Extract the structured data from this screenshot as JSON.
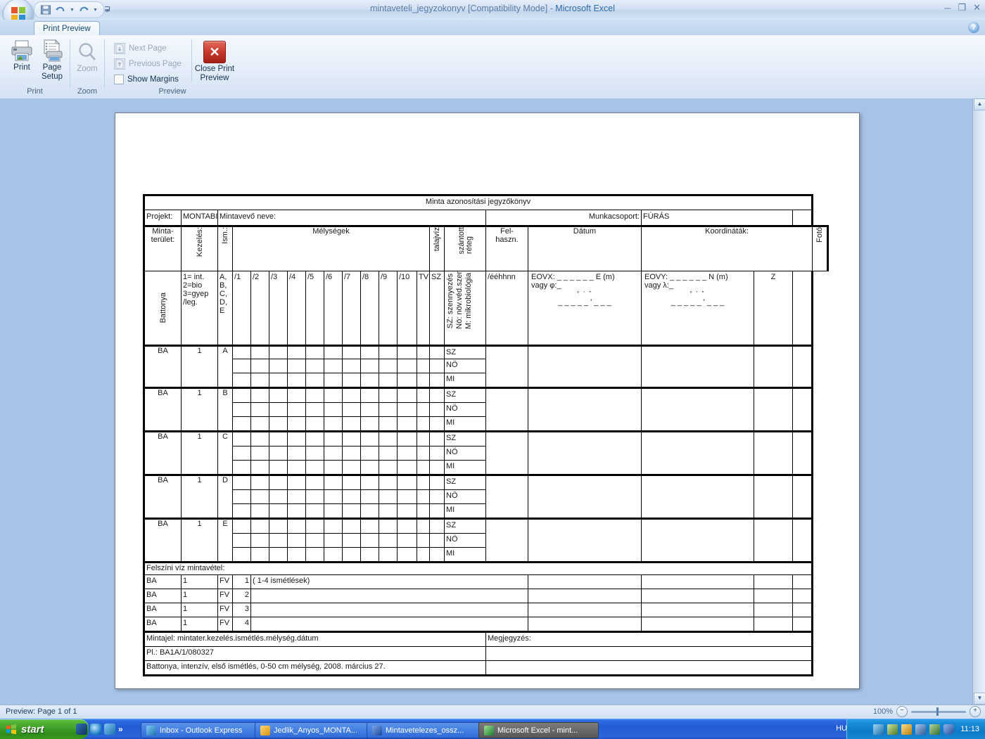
{
  "window": {
    "title_doc": "mintaveteli_jegyzokonyv",
    "title_mode": "[Compatibility Mode]",
    "title_sep": " - ",
    "title_app": "Microsoft Excel",
    "minimize": "─",
    "maximize": "❐",
    "close": "✕",
    "help": "?"
  },
  "quick_access": {
    "save": "save-icon",
    "undo": "undo-icon",
    "redo": "redo-icon",
    "customize": "customize-icon"
  },
  "ribbon": {
    "tab": "Print Preview",
    "groups": [
      {
        "label": "Print"
      },
      {
        "label": "Zoom"
      },
      {
        "label": "Preview"
      }
    ],
    "print_button": "Print",
    "page_setup_button_l1": "Page",
    "page_setup_button_l2": "Setup",
    "zoom_button": "Zoom",
    "next_page": "Next Page",
    "previous_page": "Previous Page",
    "show_margins": "Show Margins",
    "close_preview_l1": "Close Print",
    "close_preview_l2": "Preview",
    "close_glyph": "✕"
  },
  "statusbar": {
    "preview_text": "Preview: Page 1 of 1",
    "zoom_level": "100%",
    "zoom_out": "−",
    "zoom_in": "+"
  },
  "taskbar": {
    "start": "start",
    "buttons": [
      {
        "label": "Inbox - Outlook Express",
        "active": false
      },
      {
        "label": "Jedlik_Anyos_MONTA...",
        "active": false
      },
      {
        "label": "Mintavetelezes_ossz...",
        "active": false
      },
      {
        "label": "Microsoft Excel - mint...",
        "active": true
      }
    ],
    "quicklaunch_overflow": "»",
    "language": "HU",
    "clock": "11:13"
  },
  "sheet": {
    "doc_title": "Minta azonosítási jegyzőkönyv",
    "row_project": {
      "project_label": "Projekt:",
      "project_value": "MONTABIO",
      "sampler_label": "Mintavevő neve:",
      "workgroup_label": "Munkacsoport:",
      "workgroup_value": "FÚRÁS"
    },
    "headers": {
      "area_l1": "Minta-",
      "area_l2": "terület:",
      "treatment": "Kezelés:",
      "repeat": "Ism.:",
      "depths": "Mélységek",
      "groundwater": "talajvíz",
      "plowed_l1": "szántott",
      "plowed_l2": "réteg",
      "usage_l1": "Fel-",
      "usage_l2": "haszn.",
      "date": "Dátum",
      "coords": "Koordináták:",
      "photo": "Fotó"
    },
    "subheaders": {
      "area_value": "Battonya",
      "treatment_l1": "1= int.",
      "treatment_l2": "2=bio",
      "treatment_l3": "3=gyep",
      "treatment_l4": "/leg.",
      "repeat_l1": "A,",
      "repeat_l2": "B,",
      "repeat_l3": "C,",
      "repeat_l4": "D,",
      "repeat_l5": "E",
      "depth_cols": [
        "/1",
        "/2",
        "/3",
        "/4",
        "/5",
        "/6",
        "/7",
        "/8",
        "/9",
        "/10"
      ],
      "gw_code": "TV",
      "plowed_code": "SZ",
      "usage_legend_1": "SZ: szennyezés",
      "usage_legend_2": "Nö: növ.véd.szer",
      "usage_legend_3": "M: mikrobiológia",
      "date_format": "/ééhhnn",
      "eovx_line1": "EOVX: _ _ _ _ _ _ E (m)",
      "eovx_line2": "vagy                        φ:_",
      "eovx_line3": "   °        '             \"",
      "eovx_line4": "_  _ _ _ _ '  _ _ _",
      "eovy_line1": "EOVY: _ _ _ _ _ _ N (m)",
      "eovy_line2": "vagy                        λ:_",
      "eovy_line3": "   °        '             \"",
      "eovy_line4": "_  _ _ _ _ '  _ _ _",
      "z_code": "Z"
    },
    "sample_groups": [
      {
        "area": "BA",
        "treatment": "1",
        "repeat": "A",
        "usages": [
          "SZ",
          "NÖ",
          "MI"
        ]
      },
      {
        "area": "BA",
        "treatment": "1",
        "repeat": "B",
        "usages": [
          "SZ",
          "NÖ",
          "MI"
        ]
      },
      {
        "area": "BA",
        "treatment": "1",
        "repeat": "C",
        "usages": [
          "SZ",
          "NÖ",
          "MI"
        ]
      },
      {
        "area": "BA",
        "treatment": "1",
        "repeat": "D",
        "usages": [
          "SZ",
          "NÖ",
          "MI"
        ]
      },
      {
        "area": "BA",
        "treatment": "1",
        "repeat": "E",
        "usages": [
          "SZ",
          "NÖ",
          "MI"
        ]
      }
    ],
    "surface_water": {
      "title": "Felszíni víz mintavétel:",
      "rows": [
        {
          "area": "BA",
          "treatment": "1",
          "code": "FV",
          "num": "1",
          "note": "( 1-4 ismétlések)"
        },
        {
          "area": "BA",
          "treatment": "1",
          "code": "FV",
          "num": "2",
          "note": ""
        },
        {
          "area": "BA",
          "treatment": "1",
          "code": "FV",
          "num": "3",
          "note": ""
        },
        {
          "area": "BA",
          "treatment": "1",
          "code": "FV",
          "num": "4",
          "note": ""
        }
      ]
    },
    "footer": {
      "line1": "Mintajel: mintater.kezelés.ismétlés.mélység.dátum",
      "line2": "Pl.: BA1A/1/080327",
      "line3": "Battonya, intenzív, első ismétlés, 0-50 cm mélység, 2008. március 27.",
      "remarks": "Megjegyzés:"
    }
  }
}
